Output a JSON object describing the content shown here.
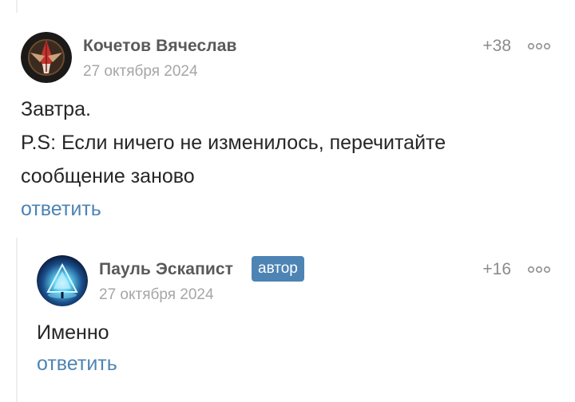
{
  "comments": [
    {
      "author": "Кочетов Вячеслав",
      "date": "27 октября 2024",
      "rating": "+38",
      "body_lines": [
        "Завтра.",
        "P.S: Если ничего не изменилось, перечитайте сообщение заново"
      ],
      "reply_label": "ответить",
      "avatar_icon": "red-winged-emblem-avatar",
      "more_icon": "more-dots-icon"
    },
    {
      "author": "Пауль Эскапист",
      "badge": "автор",
      "date": "27 октября 2024",
      "rating": "+16",
      "body_lines": [
        "Именно"
      ],
      "reply_label": "ответить",
      "avatar_icon": "glowing-pyramid-avatar",
      "more_icon": "more-dots-icon"
    }
  ],
  "colors": {
    "link": "#4d84b4",
    "badge_bg": "#4d84b4",
    "meta": "#a6a6a6",
    "author": "#595959"
  }
}
